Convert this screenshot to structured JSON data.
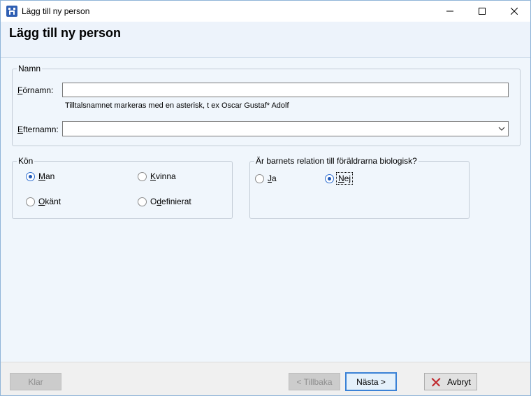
{
  "window": {
    "title": "Lägg till ny person"
  },
  "header": {
    "title": "Lägg till ny person"
  },
  "name_group": {
    "legend": "Namn",
    "first_name_label_prefix": "F",
    "first_name_label_rest": "örnamn:",
    "first_name_value": "",
    "hint": "Tilltalsnamnet markeras med en asterisk, t ex  Oscar Gustaf* Adolf",
    "last_name_label_prefix": "E",
    "last_name_label_rest": "fternamn:",
    "last_name_value": ""
  },
  "gender_group": {
    "legend": "Kön",
    "options": [
      {
        "prefix": "M",
        "rest": "an",
        "checked": true
      },
      {
        "prefix": "K",
        "rest": "vinna",
        "checked": false
      },
      {
        "prefix": "O",
        "rest": "känt",
        "checked": false
      },
      {
        "pre": "O",
        "prefix": "d",
        "rest": "efinierat",
        "checked": false
      }
    ]
  },
  "relation_group": {
    "legend": "Är barnets relation till föräldrarna biologisk?",
    "options": [
      {
        "prefix": "J",
        "rest": "a",
        "checked": false
      },
      {
        "prefix": "N",
        "rest": "ej",
        "checked": true
      }
    ]
  },
  "footer": {
    "finish_label": "Klar",
    "back_label": "< Tillbaka",
    "next_label": "Nästa >",
    "cancel_label": "Avbryt"
  },
  "colors": {
    "accent": "#3b82d6",
    "content_bg": "#f0f6fc",
    "cancel_icon": "#c0282d"
  },
  "icons": {
    "app": "app-logo-icon",
    "minimize": "minimize-icon",
    "maximize": "maximize-icon",
    "close": "close-icon",
    "combo": "chevron-down-icon",
    "cancel": "red-x-icon"
  }
}
